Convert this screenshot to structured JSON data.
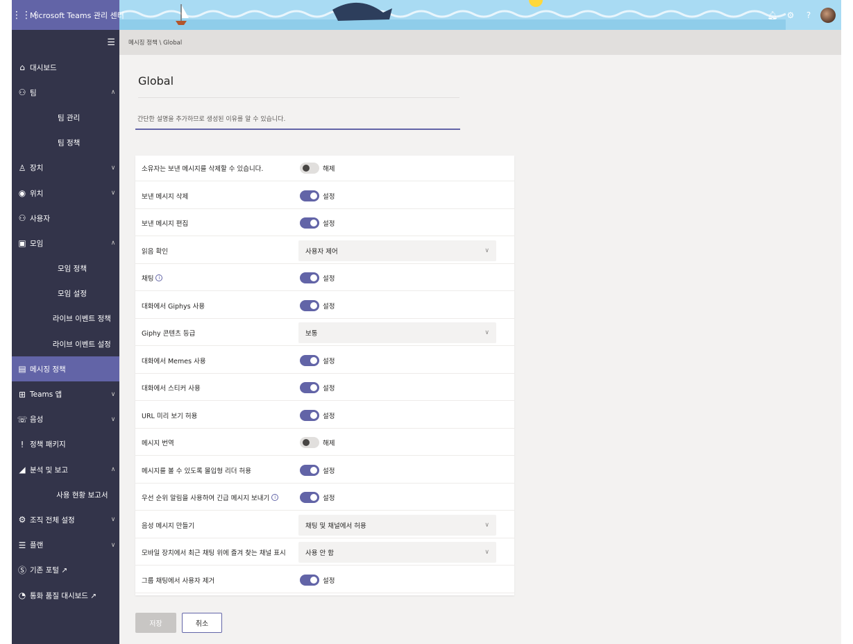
{
  "colors": {
    "brand": "#6264a7",
    "sidebar": "#33344a",
    "page_bg": "#f3f2f1",
    "banner_sky": "#a9dbf3"
  },
  "header": {
    "app_title": "Microsoft Teams 관리 센터",
    "icons": [
      "app-grid-icon",
      "bell-icon",
      "gear-icon",
      "help-icon",
      "avatar"
    ],
    "help_glyph": "?"
  },
  "sidebar": {
    "items": [
      {
        "id": "dashboard",
        "label": "대시보드",
        "icon": "home-icon",
        "level": 0,
        "chevron": ""
      },
      {
        "id": "teams",
        "label": "팀",
        "icon": "teams-icon",
        "level": 0,
        "chevron": "^"
      },
      {
        "id": "teams-manage",
        "label": "팀 관리",
        "icon": "",
        "level": 1,
        "chevron": ""
      },
      {
        "id": "teams-policies",
        "label": "팀 정책",
        "icon": "",
        "level": 1,
        "chevron": ""
      },
      {
        "id": "devices",
        "label": "장치",
        "icon": "device-icon",
        "level": 0,
        "chevron": "v"
      },
      {
        "id": "locations",
        "label": "위치",
        "icon": "globe-icon",
        "level": 0,
        "chevron": "v"
      },
      {
        "id": "users",
        "label": "사용자",
        "icon": "users-icon",
        "level": 0,
        "chevron": ""
      },
      {
        "id": "meetings",
        "label": "모임",
        "icon": "calendar-icon",
        "level": 0,
        "chevron": "^"
      },
      {
        "id": "meeting-policies",
        "label": "모임 정책",
        "icon": "",
        "level": 1,
        "chevron": ""
      },
      {
        "id": "meeting-settings",
        "label": "모임 설정",
        "icon": "",
        "level": 1,
        "chevron": ""
      },
      {
        "id": "live-event-policies",
        "label": "라이브 이벤트 정책",
        "icon": "",
        "level": 1,
        "chevron": ""
      },
      {
        "id": "live-event-settings",
        "label": "라이브 이벤트 설정",
        "icon": "",
        "level": 1,
        "chevron": ""
      },
      {
        "id": "messaging-policies",
        "label": "메시징 정책",
        "icon": "message-icon",
        "level": 0,
        "chevron": "",
        "active": true
      },
      {
        "id": "teams-apps",
        "label": "Teams 앱",
        "icon": "apps-icon",
        "level": 0,
        "chevron": "v"
      },
      {
        "id": "voice",
        "label": "음성",
        "icon": "voice-icon",
        "level": 0,
        "chevron": "v"
      },
      {
        "id": "policy-packages",
        "label": "정책 패키지",
        "icon": "package-icon",
        "level": 0,
        "chevron": ""
      },
      {
        "id": "analytics",
        "label": "분석 및 보고",
        "icon": "analytics-icon",
        "level": 0,
        "chevron": "^"
      },
      {
        "id": "usage-reports",
        "label": "사용 현황 보고서",
        "icon": "",
        "level": 1,
        "chevron": ""
      },
      {
        "id": "org-settings",
        "label": "조직 전체 설정",
        "icon": "org-settings-icon",
        "level": 0,
        "chevron": "v"
      },
      {
        "id": "planning",
        "label": "플랜",
        "icon": "planning-icon",
        "level": 0,
        "chevron": "v"
      },
      {
        "id": "legacy-portal",
        "label": "기존 포털 ↗",
        "icon": "skype-icon",
        "level": 0,
        "chevron": ""
      },
      {
        "id": "call-quality",
        "label": "통화 품질 대시보드 ↗",
        "icon": "gauge-icon",
        "level": 0,
        "chevron": ""
      }
    ]
  },
  "breadcrumb": "메시징 정책 \\ Global",
  "page": {
    "title": "Global",
    "description_placeholder": "간단한 설명을 추가하므로 생성된 이유를 알 수 있습니다."
  },
  "settings": [
    {
      "label": "소유자는 보낸 메시지를 삭제할 수 있습니다.",
      "type": "toggle",
      "on": false,
      "state": "해제",
      "info": false
    },
    {
      "label": "보낸 메시지 삭제",
      "type": "toggle",
      "on": true,
      "state": "설정",
      "info": false
    },
    {
      "label": "보낸 메시지 편집",
      "type": "toggle",
      "on": true,
      "state": "설정",
      "info": false
    },
    {
      "label": "읽음 확인",
      "type": "dropdown",
      "value": "사용자 제어",
      "info": false
    },
    {
      "label": "채팅",
      "type": "toggle",
      "on": true,
      "state": "설정",
      "info": true
    },
    {
      "label": "대화에서 Giphys 사용",
      "type": "toggle",
      "on": true,
      "state": "설정",
      "info": false
    },
    {
      "label": "Giphy 콘텐츠 등급",
      "type": "dropdown",
      "value": "보통",
      "info": false
    },
    {
      "label": "대화에서 Memes 사용",
      "type": "toggle",
      "on": true,
      "state": "설정",
      "info": false
    },
    {
      "label": "대화에서 스티커 사용",
      "type": "toggle",
      "on": true,
      "state": "설정",
      "info": false
    },
    {
      "label": "URL 미리 보기 허용",
      "type": "toggle",
      "on": true,
      "state": "설정",
      "info": false
    },
    {
      "label": "메시지 번역",
      "type": "toggle",
      "on": false,
      "state": "해제",
      "info": false
    },
    {
      "label": "메시지를 볼 수 있도록 몰입형 리더 허용",
      "type": "toggle",
      "on": true,
      "state": "설정",
      "info": false
    },
    {
      "label": "우선 순위 알림을 사용하여 긴급 메시지 보내기",
      "type": "toggle",
      "on": true,
      "state": "설정",
      "info": true
    },
    {
      "label": "음성 메시지 만들기",
      "type": "dropdown",
      "value": "채팅 및 채널에서 허용",
      "info": false
    },
    {
      "label": "모바일 장치에서 최근 채팅 위에 즐겨 찾는 채널 표시",
      "type": "dropdown",
      "value": "사용 안 함",
      "info": false
    },
    {
      "label": "그룹 채팅에서 사용자 제거",
      "type": "toggle",
      "on": true,
      "state": "설정",
      "info": false
    }
  ],
  "actions": {
    "save_label": "저장",
    "cancel_label": "취소"
  }
}
